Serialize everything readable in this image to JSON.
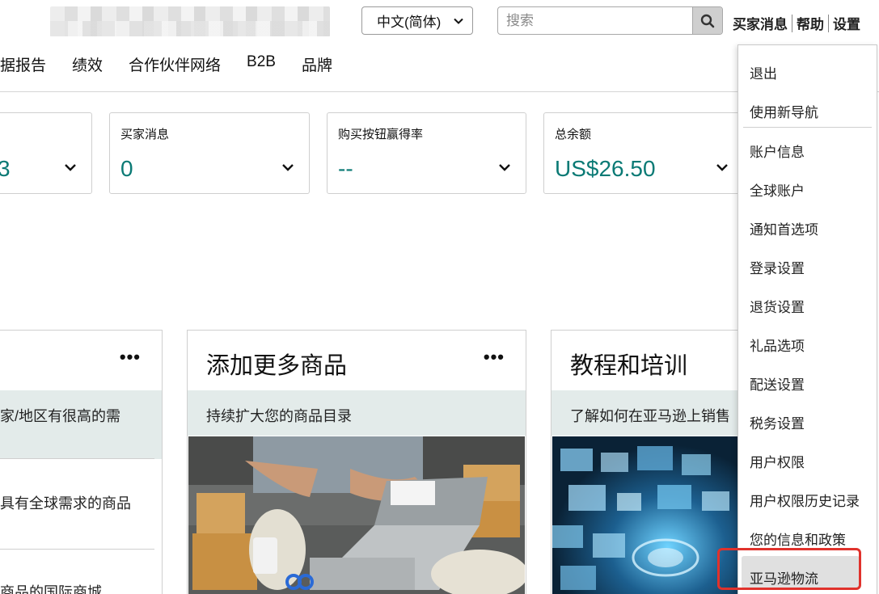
{
  "header": {
    "language": "中文(简体)",
    "search_placeholder": "搜索",
    "links": [
      "买家消息",
      "帮助",
      "设置"
    ]
  },
  "nav": {
    "items": [
      "据报告",
      "绩效",
      "合作伙伴网络",
      "B2B",
      "品牌"
    ]
  },
  "metrics": [
    {
      "label": "",
      "value": "3"
    },
    {
      "label": "买家消息",
      "value": "0"
    },
    {
      "label": "购买按钮赢得率",
      "value": "--"
    },
    {
      "label": "总余额",
      "value": "US$26.50"
    }
  ],
  "panels": {
    "left": {
      "subtitle": "家/地区有很高的需",
      "rows": [
        "具有全球需求的商品",
        "商品的国际商城"
      ]
    },
    "middle": {
      "title": "添加更多商品",
      "subtitle": "持续扩大您的商品目录"
    },
    "right": {
      "title": "教程和培训",
      "subtitle": "了解如何在亚马逊上销售"
    }
  },
  "settings_menu": {
    "items": [
      "退出",
      "使用新导航",
      "账户信息",
      "全球账户",
      "通知首选项",
      "登录设置",
      "退货设置",
      "礼品选项",
      "配送设置",
      "税务设置",
      "用户权限",
      "用户权限历史记录",
      "您的信息和政策",
      "亚马逊物流"
    ],
    "highlighted": "亚马逊物流"
  },
  "colors": {
    "accent_teal": "#0b7a75",
    "band": "#e3ebea",
    "highlight_border": "#e0322c"
  }
}
